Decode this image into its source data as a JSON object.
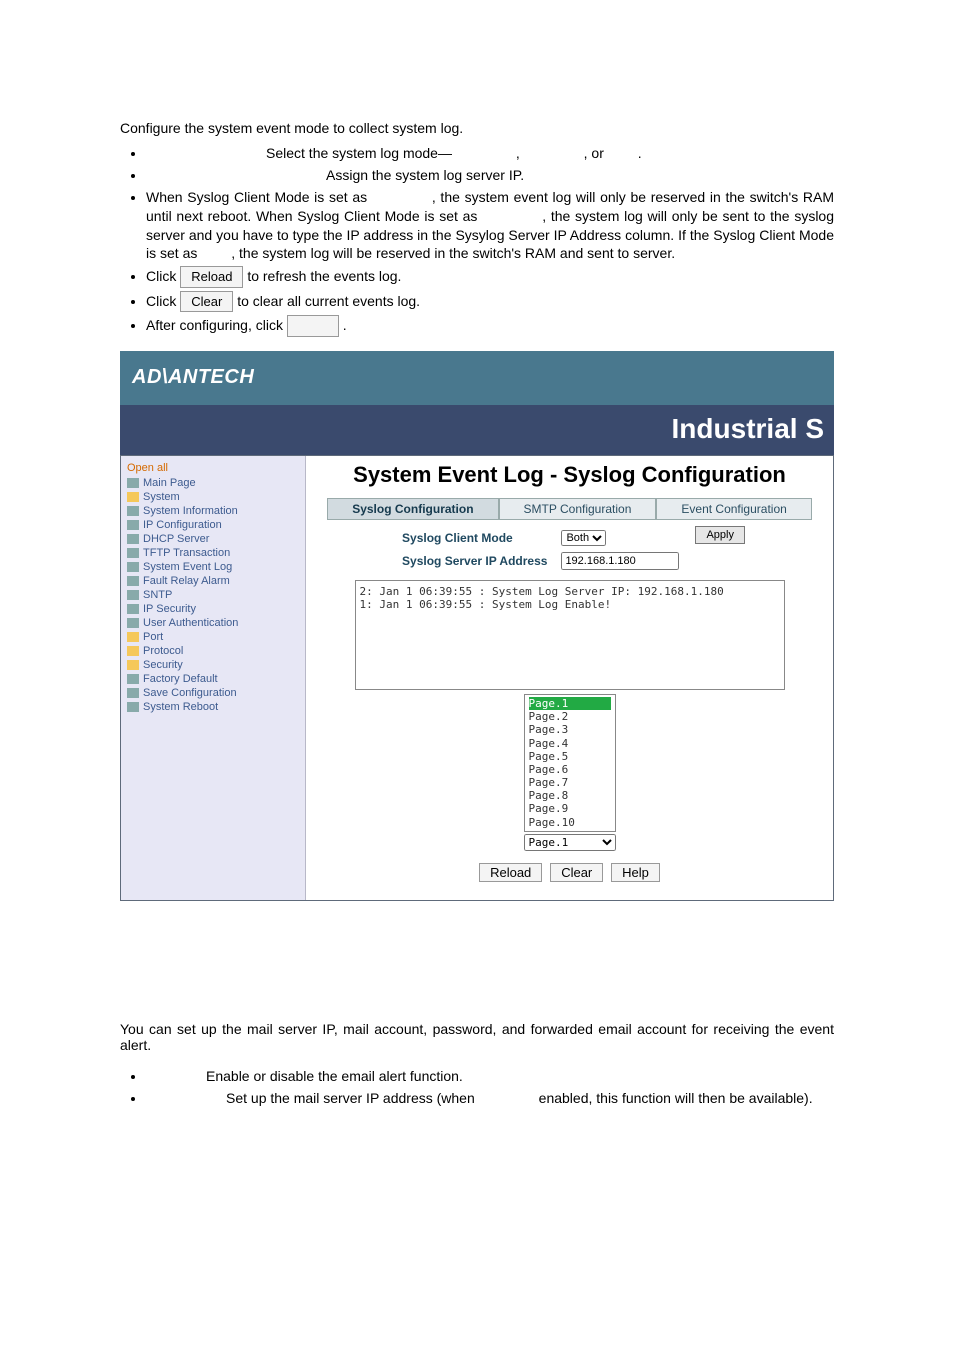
{
  "intro": "Configure the system event mode to collect system log.",
  "b1": "Select the system log mode—",
  "b1mid": ",",
  "b1or": ", or",
  "b1end": ".",
  "b2": "Assign the system log server IP.",
  "b3a": "When Syslog Client Mode is set as ",
  "b3b": ", the system event log will only be reserved in the switch's RAM until next reboot. When Syslog Client Mode is set as ",
  "b3c": ", the system log will only be sent to the syslog server and you have to type the IP address in the Sysylog Server IP Address column. If the Syslog Client Mode is set as ",
  "b3d": ", the system log will be reserved in the switch's RAM and sent to server.",
  "b4a": "Click ",
  "b4btn": "Reload",
  "b4b": " to refresh the events log.",
  "b5a": "Click ",
  "b5btn": "Clear",
  "b5b": " to clear all current events log.",
  "b6": "After configuring, click ",
  "b6end": ".",
  "brand": "AD\\ANTECH",
  "subbar": "Industrial S",
  "sidebar": {
    "openall": "Open all",
    "items": [
      {
        "lvl": 1,
        "icon": "page",
        "label": "Main Page"
      },
      {
        "lvl": 0,
        "icon": "folder",
        "label": "System"
      },
      {
        "lvl": 2,
        "icon": "page",
        "label": "System Information"
      },
      {
        "lvl": 2,
        "icon": "page",
        "label": "IP Configuration"
      },
      {
        "lvl": 2,
        "icon": "page",
        "label": "DHCP Server"
      },
      {
        "lvl": 2,
        "icon": "page",
        "label": "TFTP Transaction"
      },
      {
        "lvl": 2,
        "icon": "page",
        "label": "System Event Log"
      },
      {
        "lvl": 2,
        "icon": "page",
        "label": "Fault Relay Alarm"
      },
      {
        "lvl": 2,
        "icon": "page",
        "label": "SNTP"
      },
      {
        "lvl": 2,
        "icon": "page",
        "label": "IP Security"
      },
      {
        "lvl": 2,
        "icon": "page",
        "label": "User Authentication"
      },
      {
        "lvl": 0,
        "icon": "folder",
        "label": "Port"
      },
      {
        "lvl": 0,
        "icon": "folder",
        "label": "Protocol"
      },
      {
        "lvl": 0,
        "icon": "folder",
        "label": "Security"
      },
      {
        "lvl": 1,
        "icon": "page",
        "label": "Factory Default"
      },
      {
        "lvl": 1,
        "icon": "page",
        "label": "Save Configuration"
      },
      {
        "lvl": 1,
        "icon": "page",
        "label": "System Reboot"
      }
    ]
  },
  "ctitle": "System Event Log - Syslog Configuration",
  "tabs": {
    "a": "Syslog Configuration",
    "b": "SMTP Configuration",
    "c": "Event Configuration"
  },
  "form": {
    "mode_label": "Syslog Client Mode",
    "mode_value": "Both",
    "ip_label": "Syslog Server IP Address",
    "ip_value": "192.168.1.180",
    "apply": "Apply"
  },
  "log": {
    "l2": "2: Jan 1 06:39:55 : System Log Server IP: 192.168.1.180",
    "l1": "1: Jan 1 06:39:55 : System Log Enable!"
  },
  "pages": [
    "Page.1",
    "Page.2",
    "Page.3",
    "Page.4",
    "Page.5",
    "Page.6",
    "Page.7",
    "Page.8",
    "Page.9",
    "Page.10"
  ],
  "page_sel": "Page.1",
  "btns": {
    "reload": "Reload",
    "clear": "Clear",
    "help": "Help"
  },
  "smtp": {
    "p": "You can set up the mail server IP, mail account, password, and forwarded email account for receiving the event alert.",
    "i1": "Enable or disable the email alert function.",
    "i2a": "Set up the mail server IP address (when ",
    "i2b": " enabled, this function will then be available)."
  }
}
